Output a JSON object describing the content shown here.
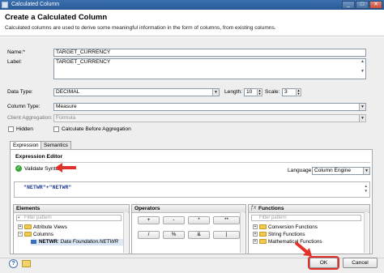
{
  "window": {
    "title": "Calculated Column"
  },
  "header": {
    "title": "Create a Calculated Column",
    "subtitle": "Calculated columns are used to derive some meaningful information in the form of columns, from existing columns."
  },
  "form": {
    "name_label": "Name:*",
    "name_value": "TARGET_CURRENCY",
    "label_label": "Label:",
    "label_value": "TARGET_CURRENCY",
    "data_type_label": "Data Type:",
    "data_type_value": "DECIMAL",
    "length_label": "Length:",
    "length_value": "10",
    "scale_label": "Scale:",
    "scale_value": "3",
    "column_type_label": "Column Type:",
    "column_type_value": "Measure",
    "client_agg_label": "Client Aggregation:",
    "client_agg_value": "Formula",
    "hidden_label": "Hidden",
    "calc_before_agg_label": "Calculate Before Aggregation"
  },
  "tabs": {
    "expression": "Expression",
    "semantics": "Semantics"
  },
  "editor": {
    "title": "Expression Editor",
    "validate_label": "Validate Syntax",
    "language_label": "Language:",
    "language_value": "Column Engine",
    "expression": "\"NETWR\"+\"NETWR\""
  },
  "elements": {
    "title": "Elements",
    "filter_placeholder": "Filter pattern",
    "items": [
      "Attribute Views",
      "Columns"
    ],
    "netwr_name": "NETWR",
    "netwr_desc": ": Data Foundation.NETWR"
  },
  "operators": {
    "title": "Operators",
    "buttons": [
      "+",
      "-",
      "*",
      "**",
      "/",
      "%",
      "&",
      "|"
    ]
  },
  "functions": {
    "title": "Functions",
    "filter_placeholder": "Filter pattern",
    "items": [
      "Conversion Functions",
      "String Functions",
      "Mathematical Functions"
    ]
  },
  "footer": {
    "help_icon": "help-icon",
    "ok_label": "OK",
    "cancel_label": "Cancel"
  },
  "colors": {
    "titlebar": "#2a5a98",
    "annotation_arrow": "#e2322a",
    "validate_check": "#3aa63a"
  }
}
